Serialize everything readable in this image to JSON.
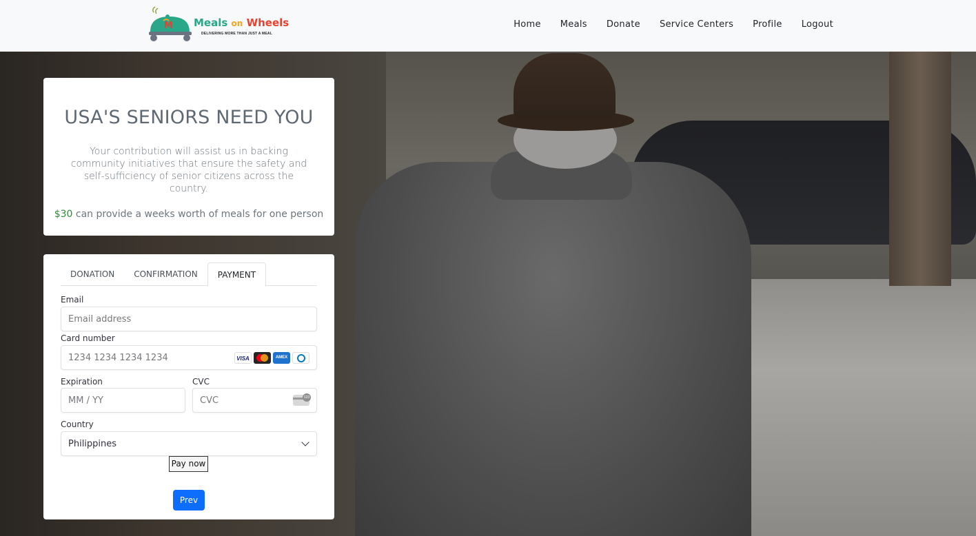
{
  "brand": {
    "logo_title_1": "Meals",
    "logo_title_2": "on",
    "logo_title_3": "Wheels",
    "logo_tagline": "DELIVERING MORE THAN JUST A MEAL",
    "colors": {
      "green": "#2aa788",
      "orange": "#f3a521",
      "red": "#e8412f"
    }
  },
  "nav": {
    "items": [
      "Home",
      "Meals",
      "Donate",
      "Service Centers",
      "Profile",
      "Logout"
    ]
  },
  "info": {
    "heading": "USA'S SENIORS NEED YOU",
    "description": "Your contribution will assist us in backing community initiatives that ensure the safety and self-sufficiency of senior citizens across the country.",
    "price_amount": "$30",
    "price_text": " can provide a weeks worth of meals for one person"
  },
  "form": {
    "tabs": [
      "DONATION",
      "CONFIRMATION",
      "PAYMENT"
    ],
    "active_tab": "PAYMENT",
    "email": {
      "label": "Email",
      "placeholder": "Email address"
    },
    "card_number": {
      "label": "Card number",
      "placeholder": "1234 1234 1234 1234",
      "brand_icons": [
        "visa-icon",
        "mastercard-icon",
        "amex-icon",
        "diners-icon"
      ]
    },
    "expiration": {
      "label": "Expiration",
      "placeholder": "MM / YY"
    },
    "cvc": {
      "label": "CVC",
      "placeholder": "CVC",
      "icon": "cvc-card-icon",
      "icon_text": "123"
    },
    "country": {
      "label": "Country",
      "value": "Philippines"
    },
    "pay_button": "Pay now",
    "prev_button": "Prev",
    "primary_color": "#0d6efd"
  }
}
